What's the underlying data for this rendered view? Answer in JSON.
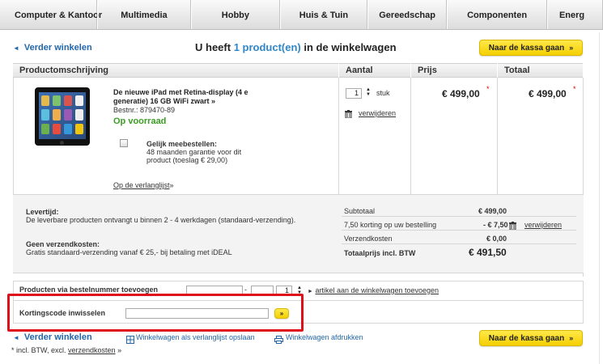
{
  "nav": [
    "Computer & Kantoor",
    "Multimedia",
    "Hobby",
    "Huis & Tuin",
    "Gereedschap",
    "Componenten",
    "Energ"
  ],
  "top": {
    "continue": "Verder winkelen",
    "heading_pre": "U heeft",
    "heading_count": "1 product(en)",
    "heading_post": "in de winkelwagen",
    "checkout": "Naar de kassa gaan"
  },
  "table": {
    "h_desc": "Productomschrijving",
    "h_qty": "Aantal",
    "h_price": "Prijs",
    "h_total": "Totaal"
  },
  "product": {
    "title": "De nieuwe iPad met Retina-display (4 e generatie) 16 GB WiFi zwart",
    "arrow": "»",
    "sku": "Bestnr.: 879470-89",
    "stock": "Op voorraad",
    "also_title": "Gelijk meebestellen:",
    "also_desc": "48 maanden garantie voor dit product (toeslag € 29,00)",
    "wishlist": "Op de verlanglijst",
    "qty": "1",
    "unit": "stuk",
    "remove": "verwijderen",
    "price": "€ 499,00",
    "total": "€ 499,00",
    "star": "*"
  },
  "delivery": {
    "title": "Levertijd:",
    "text": "De leverbare producten ontvangt u binnen 2 - 4 werkdagen (standaard-verzending).",
    "ship_title": "Geen verzendkosten:",
    "ship_text": "Gratis standaard-verzending vanaf € 25,- bij betaling met iDEAL"
  },
  "summary": {
    "subtotal_l": "Subtotaal",
    "subtotal_v": "€ 499,00",
    "discount_l": "7,50 korting op uw bestelling",
    "discount_v": "- € 7,50",
    "discount_remove": "verwijderen",
    "shipping_l": "Verzendkosten",
    "shipping_v": "€ 0,00",
    "total_l": "Totaalprijs incl. BTW",
    "total_v": "€ 491,50"
  },
  "order": {
    "label": "Producten via bestelnummer toevoegen",
    "dash": "-",
    "qty": "1",
    "add_link": "artikel aan de winkelwagen toevoegen"
  },
  "coupon": {
    "label": "Kortingscode inwisselen",
    "btn": "»"
  },
  "bottom": {
    "continue": "Verder winkelen",
    "save": "Winkelwagen als verlanglijst opslaan",
    "print": "Winkelwagen afdrukken",
    "checkout": "Naar de kassa gaan",
    "note_pre": "* incl. BTW, excl.",
    "note_link": "verzendkosten",
    "note_post": "»"
  }
}
